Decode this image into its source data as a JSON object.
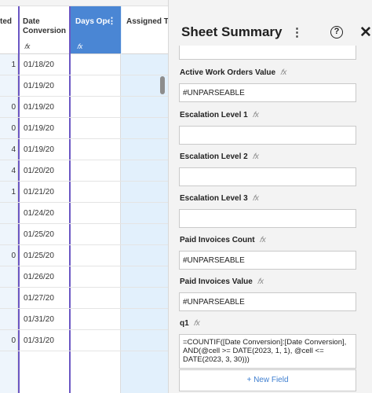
{
  "grid": {
    "columns": {
      "a": {
        "label": "ted"
      },
      "b": {
        "label": "Date Conversion",
        "icon": "fx-icon"
      },
      "c": {
        "label": "Days Ope",
        "icon": "fx-icon"
      },
      "d": {
        "label": "Assigned To"
      }
    },
    "rows": [
      {
        "a": "1",
        "b": "01/18/20"
      },
      {
        "a": "",
        "b": "01/19/20"
      },
      {
        "a": "0",
        "b": "01/19/20"
      },
      {
        "a": "0",
        "b": "01/19/20"
      },
      {
        "a": "4",
        "b": "01/19/20"
      },
      {
        "a": "4",
        "b": "01/20/20"
      },
      {
        "a": "1",
        "b": "01/21/20"
      },
      {
        "a": "",
        "b": "01/24/20"
      },
      {
        "a": "",
        "b": "01/25/20"
      },
      {
        "a": "0",
        "b": "01/25/20"
      },
      {
        "a": "",
        "b": "01/26/20"
      },
      {
        "a": "",
        "b": "01/27/20"
      },
      {
        "a": "",
        "b": "01/31/20"
      },
      {
        "a": "0",
        "b": "01/31/20"
      }
    ]
  },
  "panel": {
    "title": "Sheet Summary",
    "more_glyph": "⋮",
    "help_glyph": "?",
    "close_glyph": "✕",
    "fields": [
      {
        "label": "Active Work Orders Value",
        "fx": "𝑓x",
        "value": "#UNPARSEABLE"
      },
      {
        "label": "Escalation Level 1",
        "fx": "𝑓x",
        "value": ""
      },
      {
        "label": "Escalation Level 2",
        "fx": "𝑓x",
        "value": ""
      },
      {
        "label": "Escalation Level 3",
        "fx": "𝑓x",
        "value": ""
      },
      {
        "label": "Paid Invoices Count",
        "fx": "𝑓x",
        "value": "#UNPARSEABLE"
      },
      {
        "label": "Paid Invoices Value",
        "fx": "𝑓x",
        "value": "#UNPARSEABLE"
      },
      {
        "label": "q1",
        "fx": "𝑓x",
        "value": "=COUNTIF([Date Conversion]:[Date Conversion], AND(@cell >= DATE(2023, 1, 1), @cell <= DATE(2023, 3, 30)))"
      }
    ],
    "new_field_label": "+ New Field"
  },
  "colors": {
    "accent_blue": "#4a86d4",
    "selected_column_border": "#6b57c4",
    "link_blue": "#3f7fd0"
  }
}
